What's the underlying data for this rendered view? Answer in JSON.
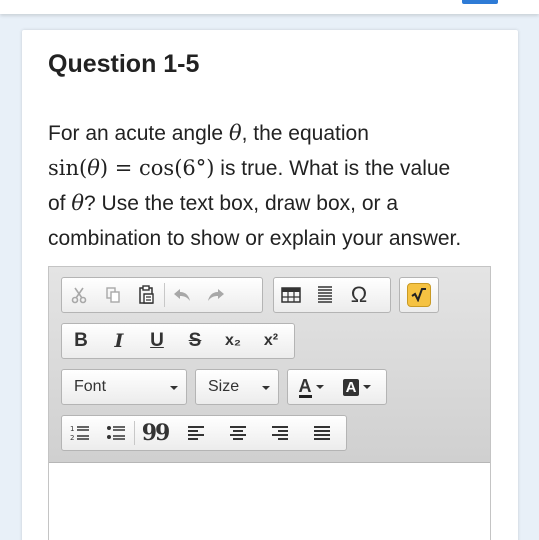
{
  "question": {
    "title": "Question 1-5",
    "text_1": "For an acute angle ",
    "theta": "θ",
    "text_2": ", the equation",
    "math_lhs": "sin(",
    "math_mid": ") = cos(6°)",
    "text_3": " is true. What is the value",
    "text_4": "of ",
    "text_5": "? Use the text box, draw box, or a",
    "text_6": "combination to show or explain your answer."
  },
  "toolbar": {
    "bold": "B",
    "italic": "I",
    "underline": "U",
    "strike": "S",
    "subscript": "x₂",
    "superscript": "x²",
    "font_label": "Font",
    "size_label": "Size",
    "text_color": "A",
    "bg_color": "A",
    "special_char": "Ω",
    "blockquote": "99"
  },
  "colors": {
    "page_bg": "#e8f0f8",
    "accent": "#2e7bd6",
    "math_btn": "#f5c242"
  }
}
